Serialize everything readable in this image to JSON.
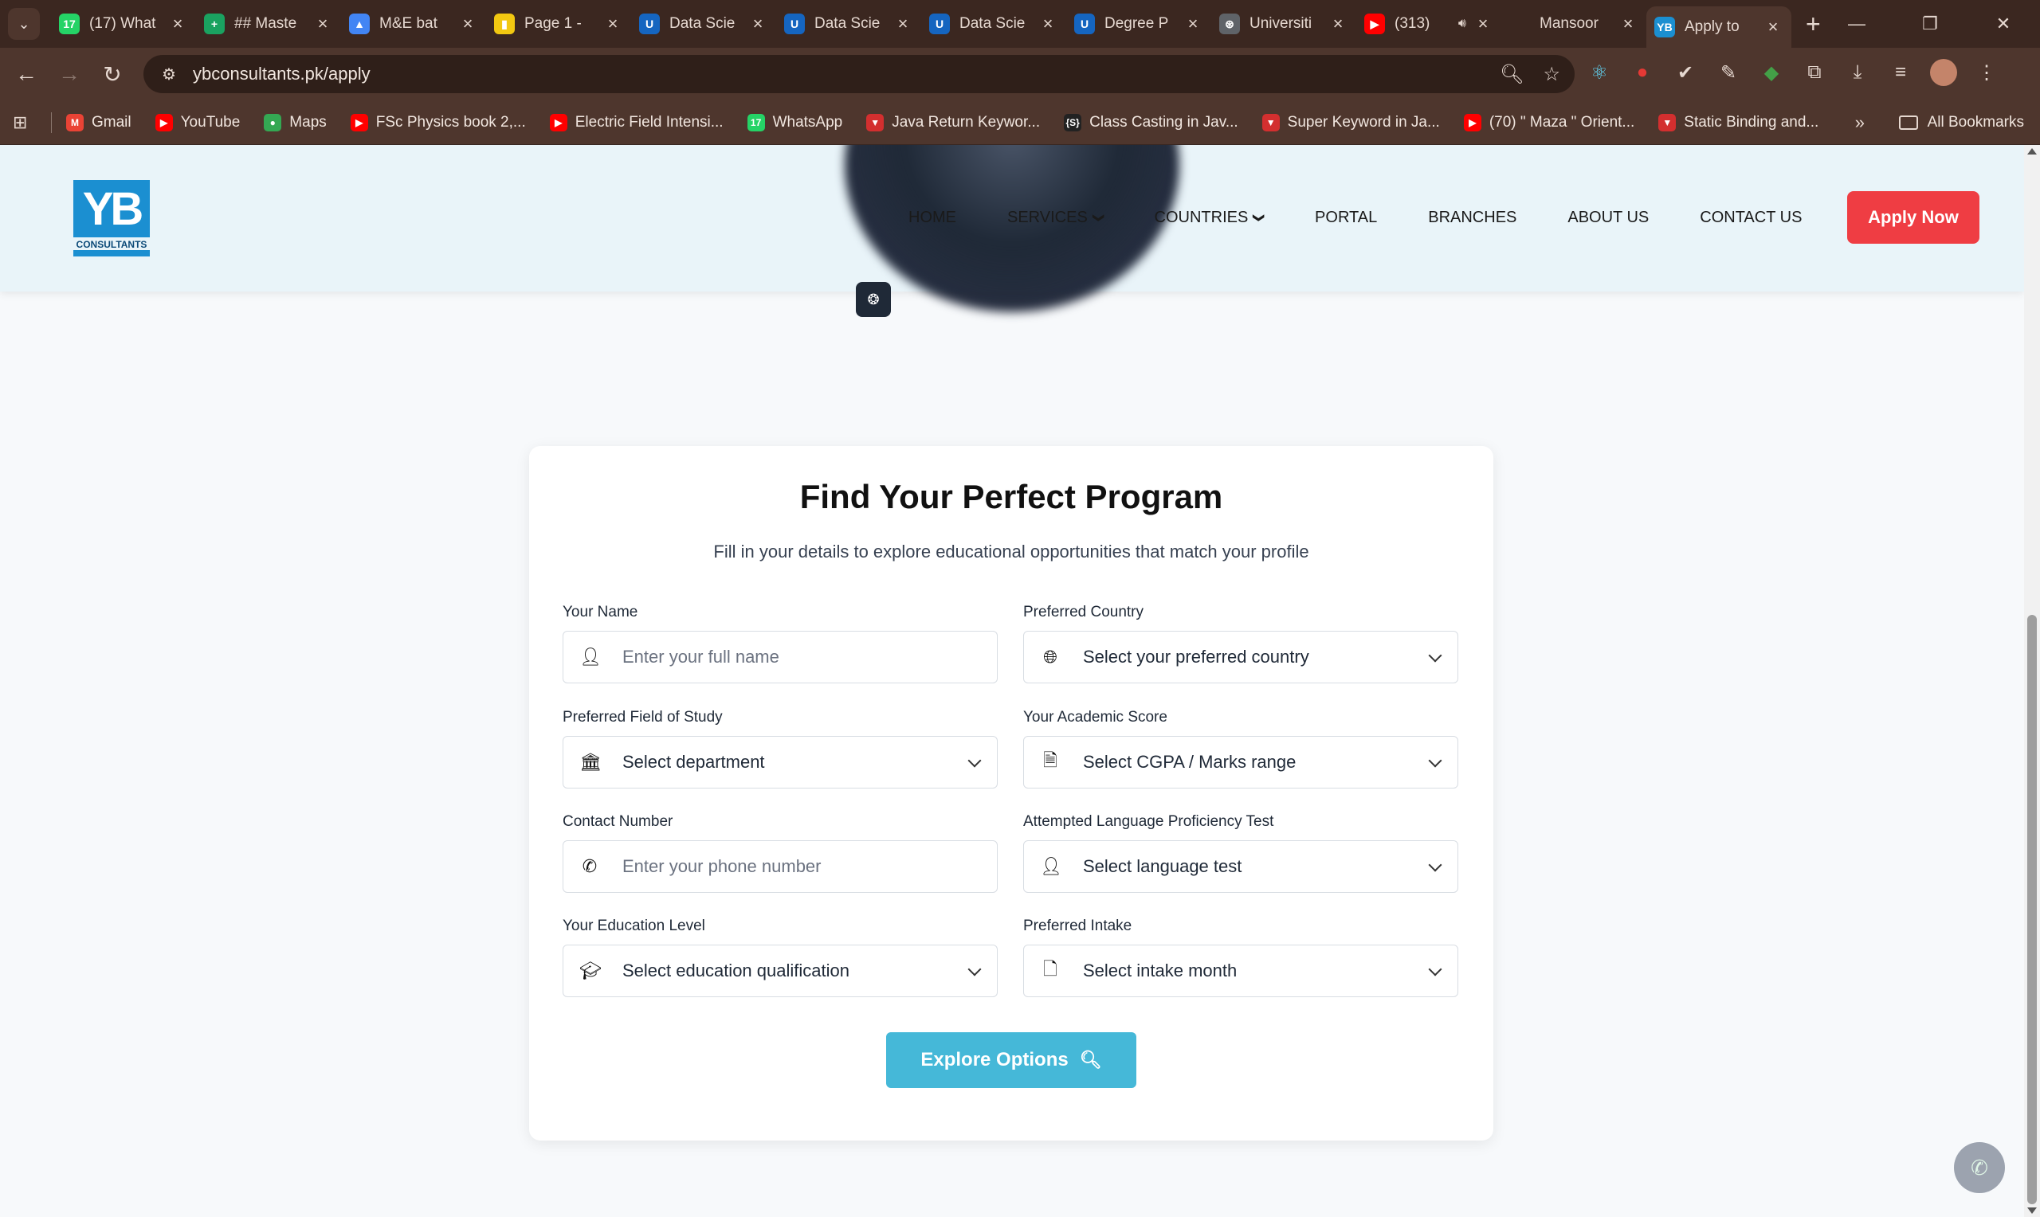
{
  "browser": {
    "tabs": [
      {
        "title": "(17) What",
        "favicon_bg": "#25d366",
        "favicon_text": "17"
      },
      {
        "title": "## Maste",
        "favicon_bg": "#1aa260",
        "favicon_text": "+"
      },
      {
        "title": "M&E bat",
        "favicon_bg": "#4285f4",
        "favicon_text": "▲"
      },
      {
        "title": "Page 1 - ",
        "favicon_bg": "#f2c811",
        "favicon_text": "▮"
      },
      {
        "title": "Data Scie",
        "favicon_bg": "#1565c0",
        "favicon_text": "U"
      },
      {
        "title": "Data Scie",
        "favicon_bg": "#1565c0",
        "favicon_text": "U"
      },
      {
        "title": "Data Scie",
        "favicon_bg": "#1565c0",
        "favicon_text": "U"
      },
      {
        "title": "Degree P",
        "favicon_bg": "#1565c0",
        "favicon_text": "U"
      },
      {
        "title": "Universiti",
        "favicon_bg": "#5f6368",
        "favicon_text": "⊛"
      },
      {
        "title": "(313)",
        "favicon_bg": "#ff0000",
        "favicon_text": "▶"
      },
      {
        "title": "Mansoor",
        "favicon_bg": "",
        "favicon_text": ""
      },
      {
        "title": "Apply to",
        "favicon_bg": "#1b8fd1",
        "favicon_text": "YB"
      }
    ],
    "url": "ybconsultants.pk/apply",
    "bookmarks": [
      {
        "label": "Gmail",
        "icon_bg": "#ea4335",
        "icon": "M"
      },
      {
        "label": "YouTube",
        "icon_bg": "#ff0000",
        "icon": "▶"
      },
      {
        "label": "Maps",
        "icon_bg": "#34a853",
        "icon": "●"
      },
      {
        "label": "FSc Physics book 2,...",
        "icon_bg": "#ff0000",
        "icon": "▶"
      },
      {
        "label": "Electric Field Intensi...",
        "icon_bg": "#ff0000",
        "icon": "▶"
      },
      {
        "label": "WhatsApp",
        "icon_bg": "#25d366",
        "icon": "17"
      },
      {
        "label": "Java Return Keywor...",
        "icon_bg": "#d32f2f",
        "icon": "▼"
      },
      {
        "label": "Class Casting in Jav...",
        "icon_bg": "#222222",
        "icon": "{S}"
      },
      {
        "label": "Super Keyword in Ja...",
        "icon_bg": "#d32f2f",
        "icon": "▼"
      },
      {
        "label": "(70) \" Maza \" Orient...",
        "icon_bg": "#ff0000",
        "icon": "▶"
      },
      {
        "label": "Static Binding and...",
        "icon_bg": "#d32f2f",
        "icon": "▼"
      }
    ],
    "all_bookmarks_label": "All Bookmarks"
  },
  "site": {
    "logo_mark": "YB",
    "logo_sub": "CONSULTANTS",
    "nav": [
      "HOME",
      "SERVICES",
      "COUNTRIES",
      "PORTAL",
      "BRANCHES",
      "ABOUT US",
      "CONTACT US"
    ],
    "apply_label": "Apply Now",
    "brand_red": "#ef3d43",
    "brand_blue": "#1b8fd1"
  },
  "form": {
    "title": "Find Your Perfect Program",
    "subtitle": "Fill in your details to explore educational opportunities that match your profile",
    "fields": {
      "name": {
        "label": "Your Name",
        "placeholder": "Enter your full name",
        "icon": "user-icon"
      },
      "country": {
        "label": "Preferred Country",
        "value": "Select your preferred country",
        "icon": "globe-icon"
      },
      "field_of_study": {
        "label": "Preferred Field of Study",
        "value": "Select department",
        "icon": "university-icon"
      },
      "score": {
        "label": "Your Academic Score",
        "value": "Select CGPA / Marks range",
        "icon": "document-icon"
      },
      "contact": {
        "label": "Contact Number",
        "placeholder": "Enter your phone number",
        "icon": "phone-icon"
      },
      "language_test": {
        "label": "Attempted Language Proficiency Test",
        "value": "Select language test",
        "icon": "user-icon"
      },
      "education": {
        "label": "Your Education Level",
        "value": "Select education qualification",
        "icon": "graduation-cap-icon"
      },
      "intake": {
        "label": "Preferred Intake",
        "value": "Select intake month",
        "icon": "file-icon"
      }
    },
    "submit_label": "Explore Options",
    "submit_color": "#45b8d8"
  }
}
